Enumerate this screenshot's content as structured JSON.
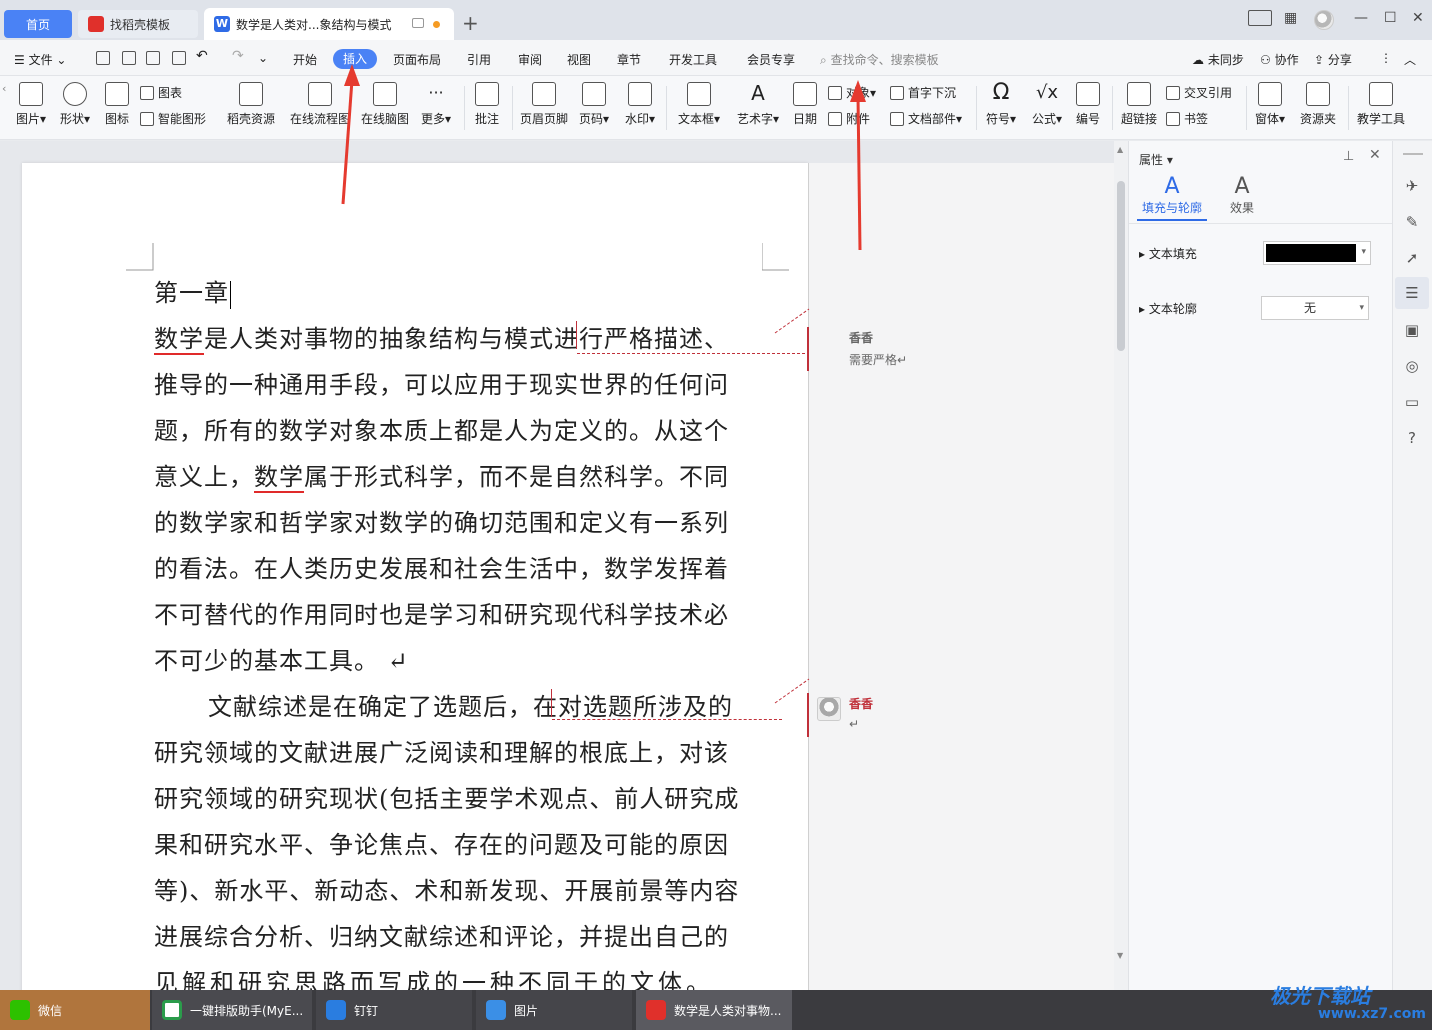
{
  "tabs": {
    "home": "首页",
    "template": "找稻壳模板",
    "document": "数学是人类对...象结构与模式"
  },
  "menu": {
    "file": "文件",
    "items": [
      "开始",
      "插入",
      "页面布局",
      "引用",
      "审阅",
      "视图",
      "章节",
      "开发工具",
      "会员专享"
    ],
    "search_placeholder": "查找命令、搜索模板",
    "sync": "未同步",
    "collab": "协作",
    "share": "分享"
  },
  "ribbon": {
    "picture": "图片",
    "shape": "形状",
    "icon": "图标",
    "chart": "图表",
    "smart_graphic": "智能图形",
    "docer_resources": "稻壳资源",
    "online_flowchart": "在线流程图",
    "online_mindmap": "在线脑图",
    "more": "更多",
    "comment": "批注",
    "header_footer": "页眉页脚",
    "page_number": "页码",
    "watermark": "水印",
    "textbox": "文本框",
    "wordart": "艺术字",
    "date": "日期",
    "object": "对象",
    "attachment": "附件",
    "drop_cap": "首字下沉",
    "doc_parts": "文档部件",
    "symbol": "符号",
    "formula": "公式",
    "numbering": "编号",
    "hyperlink": "超链接",
    "cross_ref": "交叉引用",
    "bookmark": "书签",
    "form": "窗体",
    "resource_folder": "资源夹",
    "teaching_tools": "教学工具"
  },
  "document": {
    "chapter": "第一章",
    "paragraph1": [
      "数学是人类对事物的抽象结构与模式进行严格描述、",
      "推导的一种通用手段，可以应用于现实世界的任何问",
      "题，所有的数学对象本质上都是人为定义的。从这个",
      "意义上，数学属于形式科学，而不是自然科学。不同",
      "的数学家和哲学家对数学的确切范围和定义有一系列",
      "的看法。在人类历史发展和社会生活中，数学发挥着",
      "不可替代的作用同时也是学习和研究现代科学技术必",
      "不可少的基本工具。"
    ],
    "paragraph2": [
      "文献综述是在确定了选题后，在对选题所涉及的",
      "研究领域的文献进展广泛阅读和理解的根底上，对该",
      "研究领域的研究现状(包括主要学术观点、前人研究成",
      "果和研究水平、争论焦点、存在的问题及可能的原因",
      "等)、新水平、新动态、术和新发现、开展前景等内容",
      "进展综合分析、归纳文献综述和评论，并提出自己的",
      "见解和研究思路而写成的一种不同于的文体。"
    ]
  },
  "comments": [
    {
      "author": "香香",
      "text": "需要严格"
    },
    {
      "author": "香香",
      "text": ""
    }
  ],
  "properties": {
    "title": "属性",
    "tab_fill": "填充与轮廓",
    "tab_effect": "效果",
    "text_fill": "文本填充",
    "text_outline": "文本轮廓",
    "outline_value": "无",
    "fill_color": "#000000"
  },
  "taskbar": {
    "wechat": "微信",
    "typeset": "一键排版助手(MyE...",
    "dingtalk": "钉钉",
    "photos": "图片",
    "wps": "数学是人类对事物..."
  },
  "watermark": {
    "logo": "极光下载站",
    "url": "www.xz7.com"
  },
  "colors": {
    "accent": "#4a82f5",
    "annotation_arrow": "#e53a2f",
    "comment_author": "#c0303a"
  }
}
